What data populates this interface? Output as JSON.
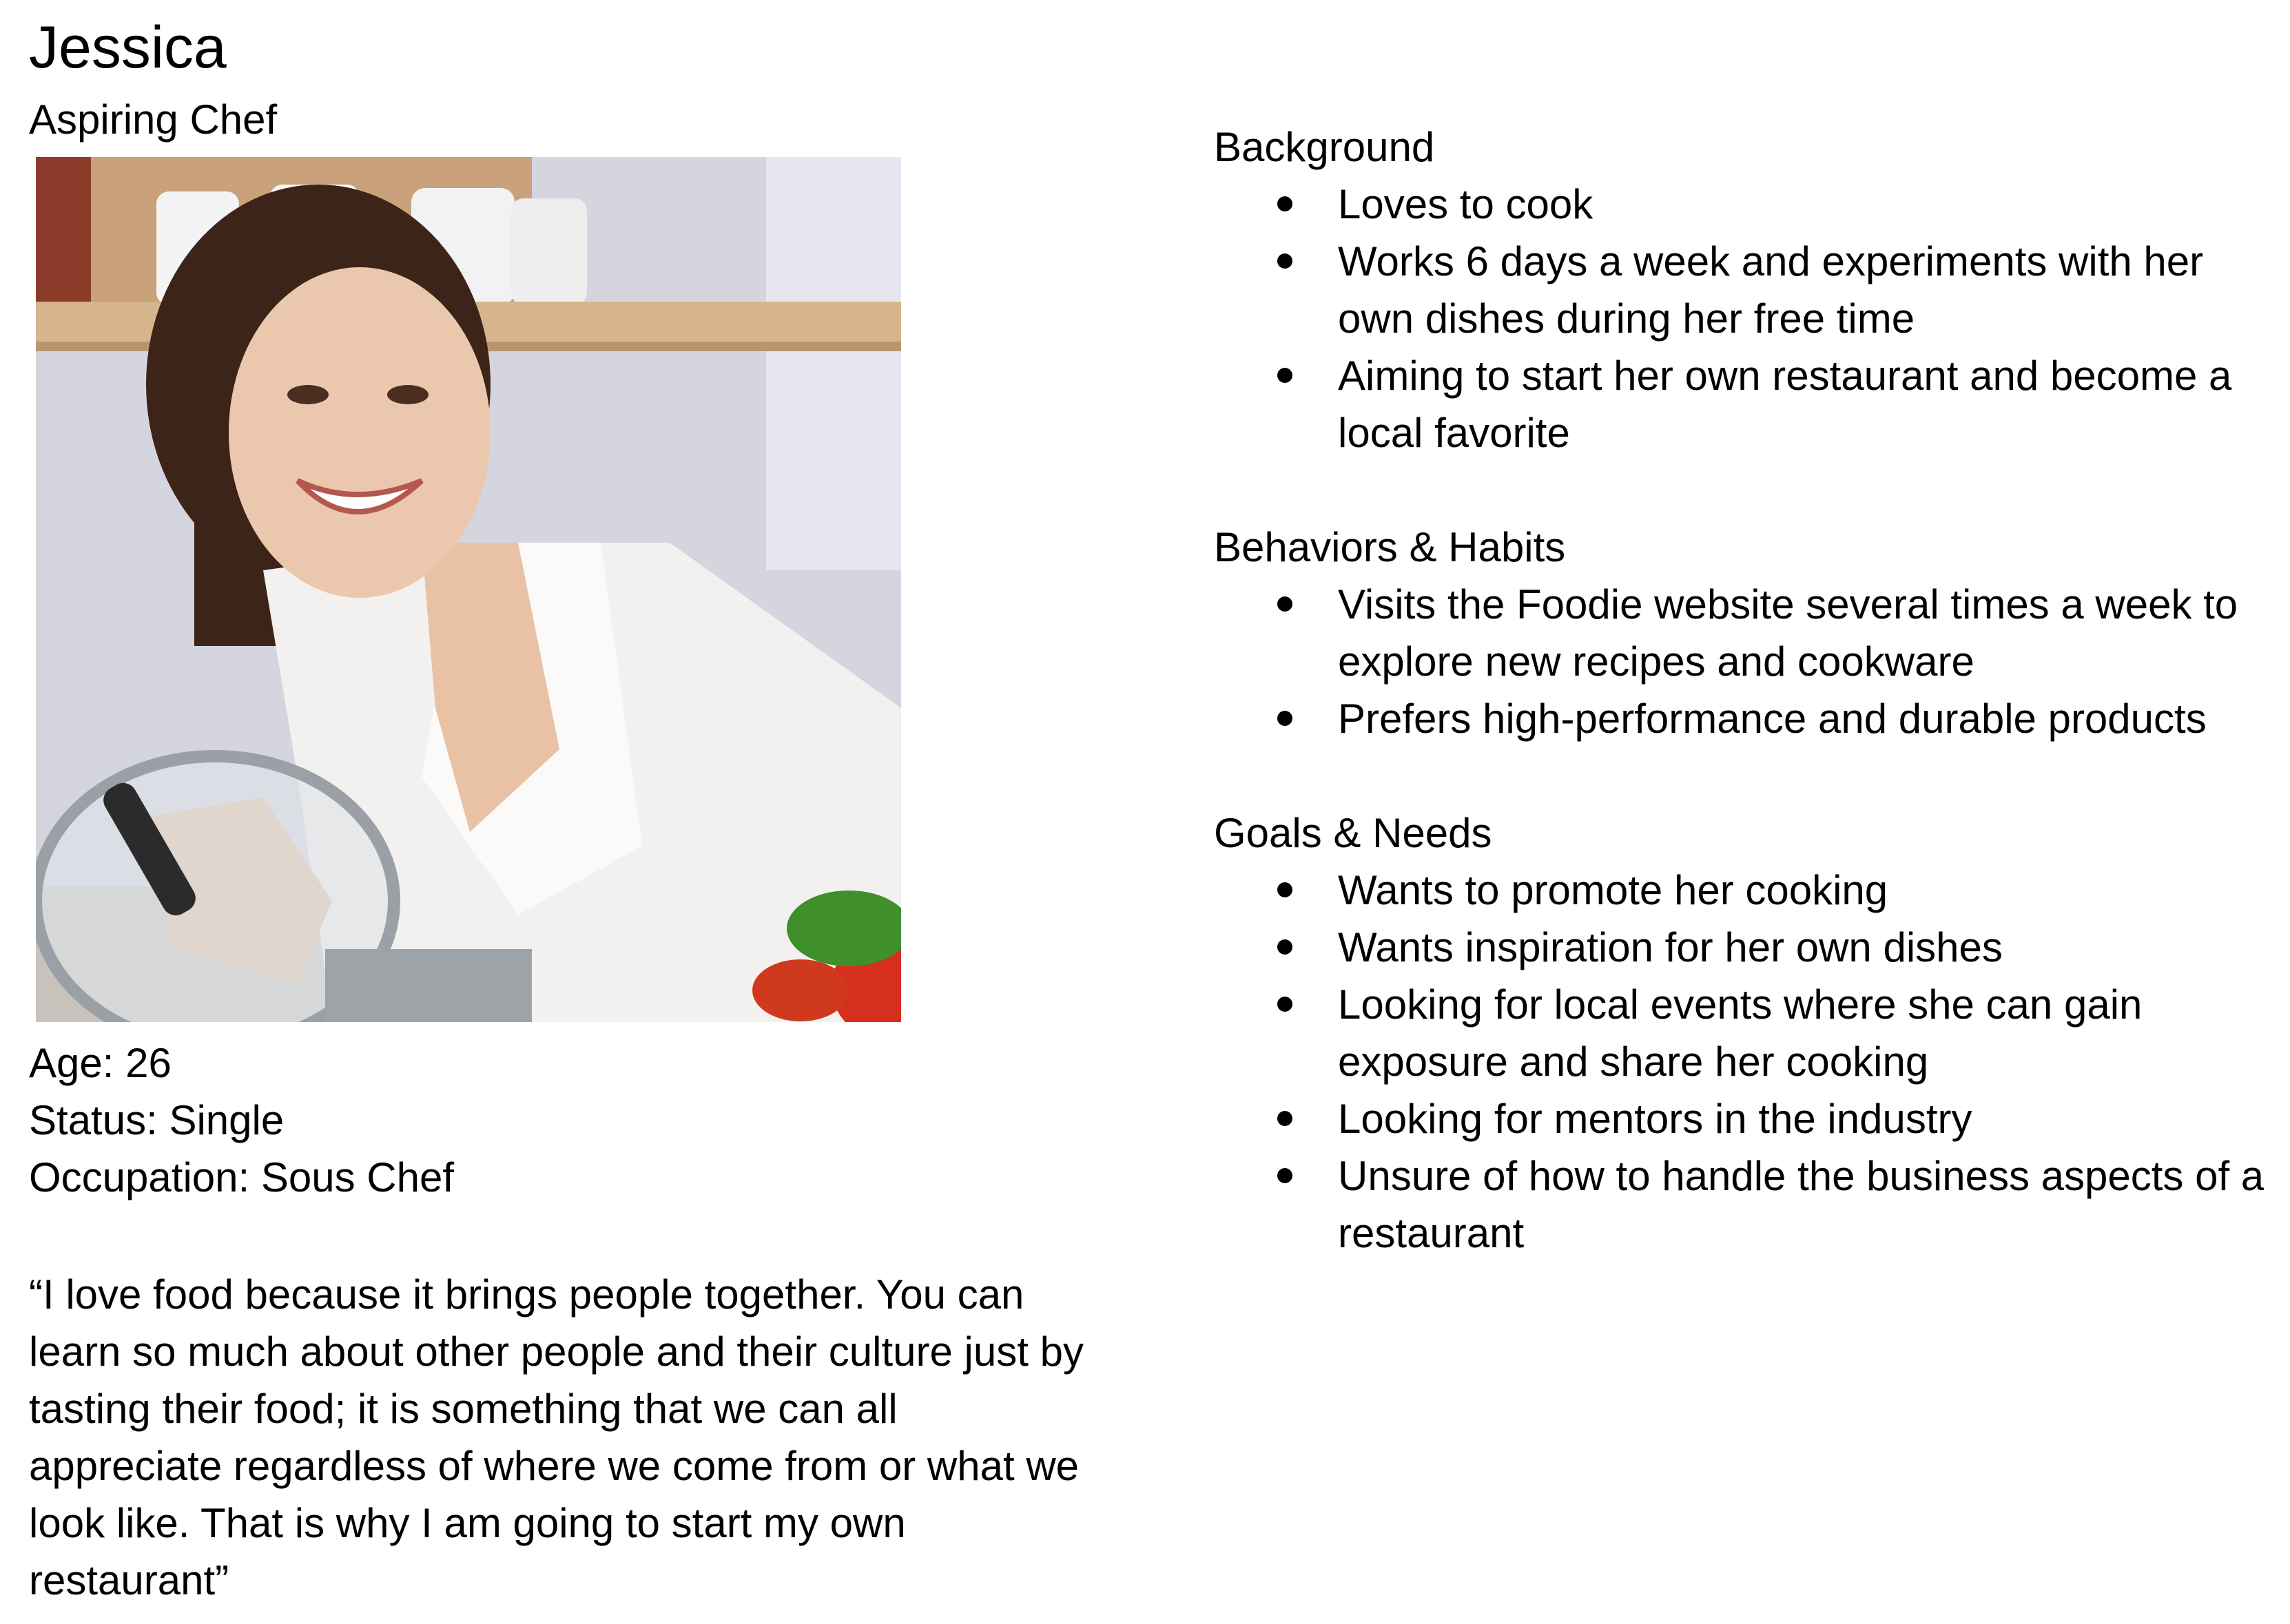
{
  "persona": {
    "name": "Jessica",
    "subtitle": "Aspiring Chef"
  },
  "facts": [
    "Age: 26",
    "Status: Single",
    "Occupation: Sous Chef"
  ],
  "quote": "“I love food because it brings people together. You can learn so much about other people and their culture just by tasting their food; it is something that we can all appreciate regardless of where we come from or what we look like. That is why I am going to start my own restaurant”",
  "sections": [
    {
      "title": "Background",
      "items": [
        "Loves to cook",
        "Works 6 days a week and experiments with her own dishes during her free time",
        "Aiming to start her own restaurant and become a local favorite"
      ]
    },
    {
      "title": "Behaviors & Habits",
      "items": [
        "Visits the Foodie website several times a week to explore new recipes and cookware",
        "Prefers high-performance and durable products"
      ]
    },
    {
      "title": "Goals & Needs",
      "items": [
        "Wants to promote her cooking",
        "Wants inspiration for her own dishes",
        "Looking for local events where she can gain exposure and share her cooking",
        "Looking for mentors in the industry",
        "Unsure of how to handle the business aspects of a restaurant"
      ]
    }
  ]
}
